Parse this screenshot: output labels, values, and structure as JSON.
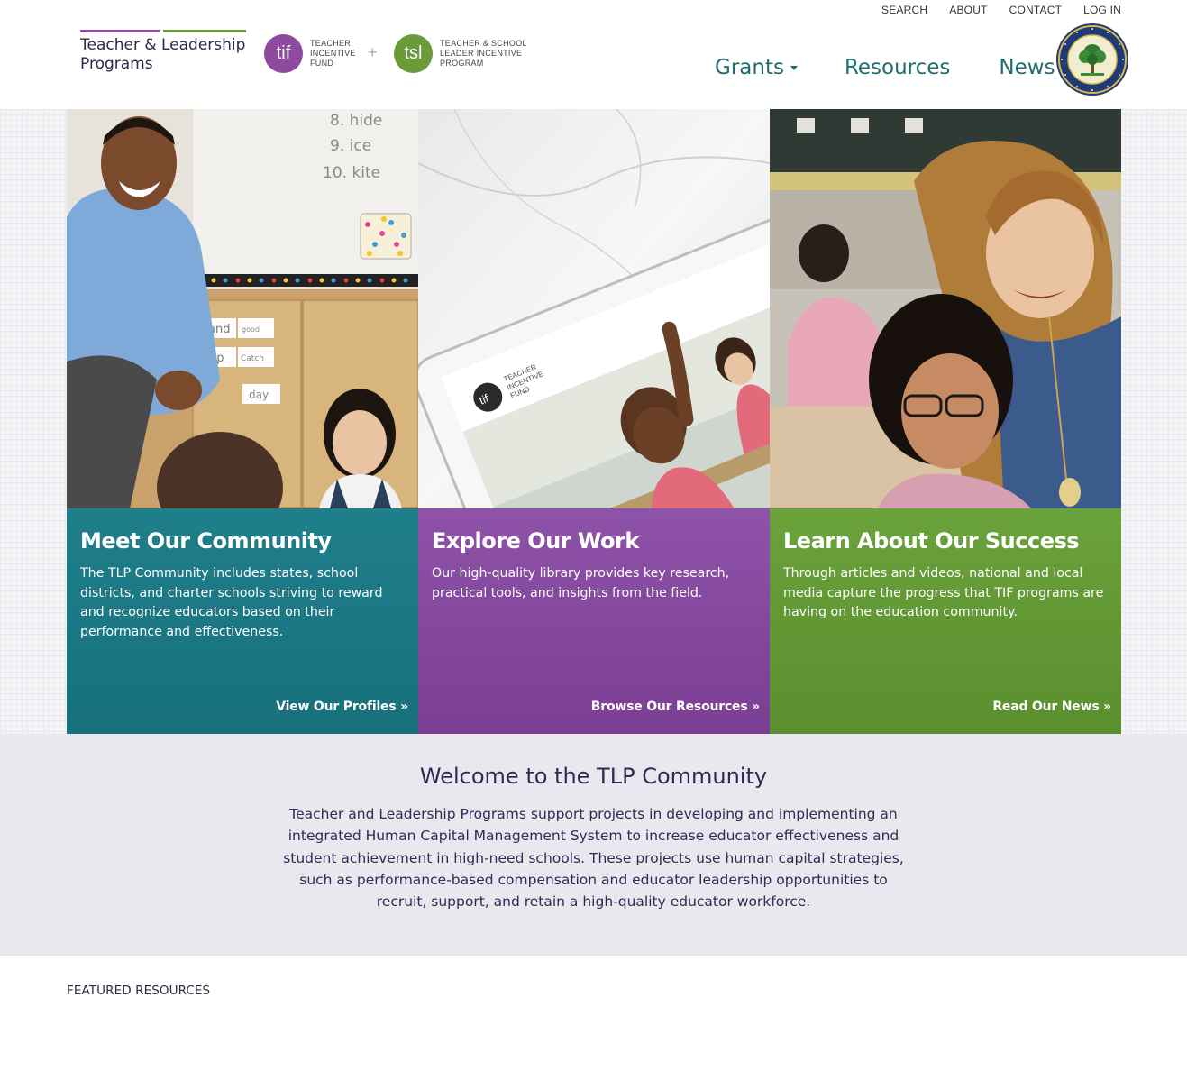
{
  "utility_nav": [
    "SEARCH",
    "ABOUT",
    "CONTACT",
    "LOG IN"
  ],
  "logo": {
    "line1": "Teacher & Leadership",
    "line2": "Programs"
  },
  "tif_badge": {
    "mark": "tif",
    "text": "TEACHER\nINCENTIVE\nFUND"
  },
  "plus": "+",
  "tsl_badge": {
    "mark": "tsl",
    "text": "TEACHER & SCHOOL\nLEADER INCENTIVE\nPROGRAM"
  },
  "main_nav": {
    "grants": "Grants",
    "resources": "Resources",
    "news": "News"
  },
  "seal": {
    "icon": "department-of-education-seal-icon",
    "text": "DEPARTMENT OF EDUCATION · UNITED STATES OF AMERICA"
  },
  "panels": [
    {
      "title": "Meet Our Community",
      "body": "The TLP Community includes states, school districts, and charter schools striving to reward and recognize educators based on their performance and effectiveness.",
      "cta": "View Our Profiles »",
      "color": "#1f7f8b",
      "photo_icon": "teacher-with-students-photo",
      "board_words": [
        "8. hide",
        "9. ice",
        "10. kite"
      ],
      "wall_words": [
        "and",
        "good",
        "up",
        "Catch",
        "day"
      ]
    },
    {
      "title": "Explore Our Work",
      "body": "Our high-quality library provides key research, practical tools, and insights from the field.",
      "cta": "Browse Our Resources »",
      "color": "#8e52a8",
      "photo_icon": "tablet-classroom-photo",
      "tablet_logo": {
        "mark": "tif",
        "text": "TEACHER\nINCENTIVE\nFUND"
      }
    },
    {
      "title": "Learn About Our Success",
      "body": "Through articles and videos, national and local media capture the progress that TIF programs are having on the education community.",
      "cta": "Read Our News »",
      "color": "#6aa23b",
      "photo_icon": "teacher-helping-student-photo"
    }
  ],
  "welcome": {
    "title": "Welcome to the TLP Community",
    "body": "Teacher and Leadership Programs support projects in developing and implementing an integrated Human Capital Management System to increase educator effectiveness and student achievement in high-need schools. These projects use human capital strategies, such as performance-based compensation and educator leadership opportunities to recruit, support, and retain a high-quality educator workforce."
  },
  "featured_heading": "FEATURED RESOURCES"
}
